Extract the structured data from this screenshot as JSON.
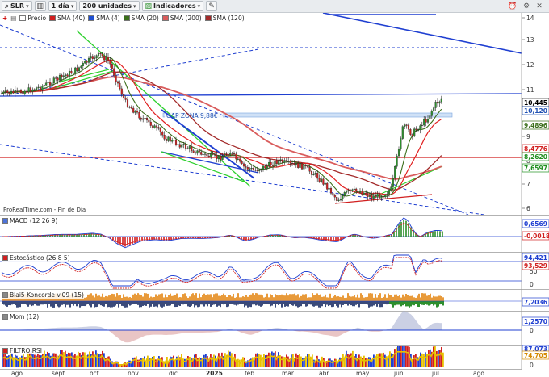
{
  "toolbar": {
    "symbol": "SLR",
    "timeframe": "1 día",
    "units": "200 unidades",
    "indicators": "Indicadores"
  },
  "price_legend": {
    "items": [
      {
        "label": "Precio",
        "color": "#222222"
      },
      {
        "label": "SMA (40)",
        "color": "#d11f1f"
      },
      {
        "label": "SMA (4)",
        "color": "#1f4fd1"
      },
      {
        "label": "SMA (20)",
        "color": "#3a6e1a"
      },
      {
        "label": "SMA (200)",
        "color": "#d95c5c"
      },
      {
        "label": "SMA (120)",
        "color": "#a32a2a"
      }
    ]
  },
  "annotation": {
    "gap_label": "GAP ZONA 9,88€"
  },
  "footnote": "ProRealTime.com - Fin de Día",
  "price_axis": {
    "ticks": [
      "14",
      "13",
      "12",
      "11",
      "9",
      "8",
      "7",
      "6"
    ]
  },
  "price_tags": [
    {
      "text": "10,445",
      "bg": "#ffffff",
      "fg": "#000000",
      "border": "#333333"
    },
    {
      "text": "10,120",
      "bg": "#ffffff",
      "fg": "#1f50b3",
      "border": "#1f50b3"
    },
    {
      "text": "9,4896",
      "bg": "#ffffff",
      "fg": "#3a6e1a",
      "border": "#3a6e1a"
    },
    {
      "text": "8,4776",
      "bg": "#ffffff",
      "fg": "#d11f1f",
      "border": "#d11f1f"
    },
    {
      "text": "8,2620",
      "bg": "#ffffff",
      "fg": "#1f8f1f",
      "border": "#1f8f1f"
    },
    {
      "text": "7,6597",
      "bg": "#ffffff",
      "fg": "#1f8f1f",
      "border": "#1f8f1f"
    }
  ],
  "macd": {
    "label": "MACD (12 26 9)",
    "tags": [
      "0,6569",
      "-0,0018"
    ],
    "ticks": []
  },
  "stoch": {
    "label": "Estocástico (26 8 5)",
    "tags": [
      "94,421",
      "93,529"
    ],
    "ticks": [
      "50",
      "0"
    ]
  },
  "blai5": {
    "label": "Blai5 Koncorde v.09 (15)",
    "tags": [
      "7,2036"
    ],
    "ticks": []
  },
  "mom": {
    "label": "Mom (12)",
    "tags": [
      "1,2570"
    ],
    "ticks": [
      "0"
    ]
  },
  "rsi": {
    "label": "FILTRO RSI",
    "tags": [
      "87,073",
      "74,705"
    ],
    "ticks": [
      "0"
    ]
  },
  "x_axis": {
    "labels": [
      "ago",
      "sept",
      "oct",
      "nov",
      "dic",
      "2025",
      "feb",
      "mar",
      "abr",
      "may",
      "jun",
      "jul",
      "ago"
    ]
  },
  "colors": {
    "up": "#2d8f2d",
    "down": "#d11f1f",
    "blue": "#1f3fd1",
    "grid": "#e4e4e4"
  }
}
